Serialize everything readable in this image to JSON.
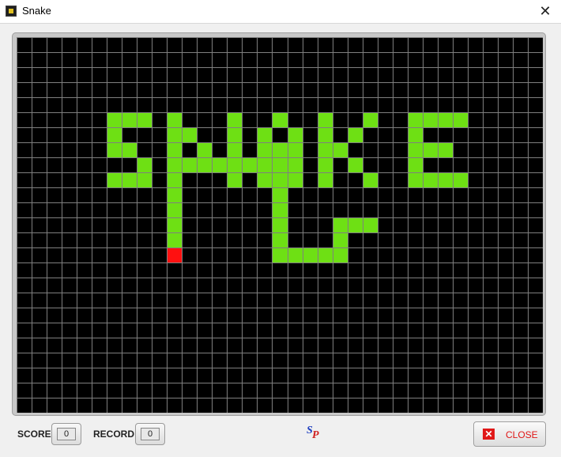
{
  "window": {
    "title": "Snake",
    "close_symbol": "✕"
  },
  "board": {
    "cols": 35,
    "rows": 25,
    "colors": {
      "background": "#000000",
      "grid": "#7f7f7f",
      "snake": "#6ee014",
      "food": "#ff1010"
    },
    "title_cells": [
      [
        6,
        5
      ],
      [
        7,
        5
      ],
      [
        8,
        5
      ],
      [
        6,
        6
      ],
      [
        6,
        7
      ],
      [
        7,
        7
      ],
      [
        8,
        8
      ],
      [
        6,
        9
      ],
      [
        7,
        9
      ],
      [
        8,
        9
      ],
      [
        10,
        5
      ],
      [
        10,
        6
      ],
      [
        10,
        7
      ],
      [
        10,
        8
      ],
      [
        10,
        9
      ],
      [
        11,
        6
      ],
      [
        12,
        7
      ],
      [
        13,
        8
      ],
      [
        14,
        5
      ],
      [
        14,
        6
      ],
      [
        14,
        7
      ],
      [
        14,
        8
      ],
      [
        14,
        9
      ],
      [
        16,
        6
      ],
      [
        16,
        7
      ],
      [
        16,
        8
      ],
      [
        16,
        9
      ],
      [
        17,
        5
      ],
      [
        17,
        7
      ],
      [
        18,
        6
      ],
      [
        18,
        7
      ],
      [
        18,
        8
      ],
      [
        18,
        9
      ],
      [
        20,
        5
      ],
      [
        20,
        6
      ],
      [
        20,
        7
      ],
      [
        20,
        8
      ],
      [
        20,
        9
      ],
      [
        21,
        7
      ],
      [
        22,
        6
      ],
      [
        22,
        8
      ],
      [
        23,
        5
      ],
      [
        23,
        9
      ],
      [
        26,
        5
      ],
      [
        27,
        5
      ],
      [
        28,
        5
      ],
      [
        29,
        5
      ],
      [
        26,
        6
      ],
      [
        26,
        7
      ],
      [
        27,
        7
      ],
      [
        28,
        7
      ],
      [
        26,
        8
      ],
      [
        26,
        9
      ],
      [
        27,
        9
      ],
      [
        28,
        9
      ],
      [
        29,
        9
      ]
    ],
    "snake_cells": [
      [
        10,
        13
      ],
      [
        10,
        12
      ],
      [
        10,
        11
      ],
      [
        10,
        10
      ],
      [
        10,
        9
      ],
      [
        10,
        8
      ],
      [
        11,
        8
      ],
      [
        12,
        8
      ],
      [
        13,
        8
      ],
      [
        14,
        8
      ],
      [
        15,
        8
      ],
      [
        16,
        8
      ],
      [
        17,
        8
      ],
      [
        17,
        9
      ],
      [
        17,
        10
      ],
      [
        17,
        11
      ],
      [
        17,
        12
      ],
      [
        17,
        13
      ],
      [
        17,
        14
      ],
      [
        18,
        14
      ],
      [
        19,
        14
      ],
      [
        20,
        14
      ],
      [
        21,
        14
      ],
      [
        21,
        13
      ],
      [
        21,
        12
      ],
      [
        22,
        12
      ],
      [
        23,
        12
      ]
    ],
    "food_cell": [
      10,
      14
    ]
  },
  "status": {
    "score_label": "SCORE",
    "score_value": "0",
    "record_label": "RECORD",
    "record_value": "0",
    "logo_s": "S",
    "logo_p": "P",
    "close_label": "CLOSE",
    "close_icon_symbol": "✕"
  }
}
